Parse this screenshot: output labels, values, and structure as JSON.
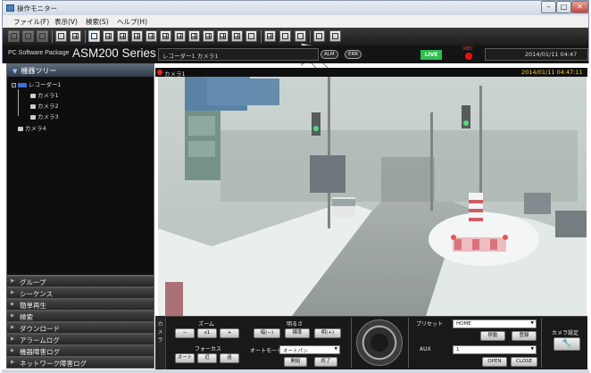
{
  "window": {
    "title": "操作モニター",
    "min_glyph": "–",
    "max_glyph": "□",
    "close_glyph": "✕"
  },
  "menu": [
    "ファイル(F)",
    "表示(V)",
    "検索(S)",
    "ヘルプ(H)"
  ],
  "header": {
    "package_label": "PC Software Package",
    "product_name": "ASM200 Series",
    "camera_field": "レコーダー1 カメラ1",
    "alm_label": "ALM",
    "err_label": "ERR",
    "live_label": "LIVE",
    "rec_label": "REC",
    "datetime": "2014/01/11  04:47"
  },
  "tree": {
    "title": "機器ツリー",
    "recorder": "レコーダー1",
    "cameras": [
      "カメラ1",
      "カメラ2",
      "カメラ3"
    ],
    "extra_camera": "カメラ4"
  },
  "accordion": [
    "グループ",
    "シーケンス",
    "簡単再生",
    "検索",
    "ダウンロード",
    "アラームログ",
    "機器障害ログ",
    "ネットワーク障害ログ"
  ],
  "view": {
    "name": "カメラ1",
    "timestamp": "2014/01/11  04:47:11"
  },
  "controls": {
    "tab_label": "カメラ",
    "zoom": {
      "label": "ズーム",
      "out": "−",
      "x1": "x1",
      "in": "+"
    },
    "focus": {
      "label": "フォーカス",
      "auto": "オート",
      "near": "近",
      "far": "遠"
    },
    "brightness": {
      "label": "明るさ",
      "dark": "暗(−)",
      "standard": "標準",
      "bright": "明(+)"
    },
    "auto_mode": {
      "label": "オートモード",
      "value": "オートパン",
      "start": "開始",
      "stop": "終了"
    },
    "preset": {
      "label": "プリセット",
      "value": "HOME",
      "move": "移動",
      "register": "登録"
    },
    "aux": {
      "label": "AUX",
      "value": "1",
      "open": "OPEN",
      "close": "CLOSE"
    },
    "camera_settings": "カメラ設定"
  }
}
